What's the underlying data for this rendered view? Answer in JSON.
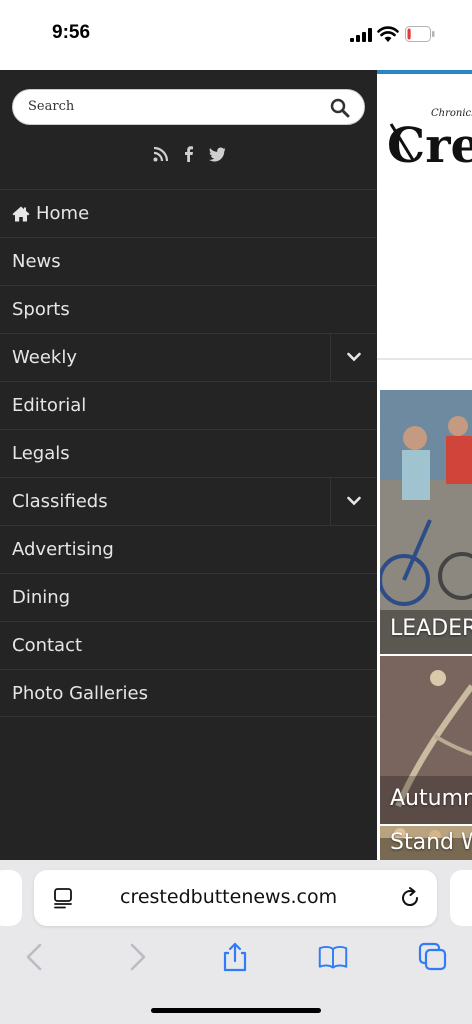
{
  "status": {
    "time": "9:56",
    "battery_level": 0.15,
    "battery_color": "#e53b30"
  },
  "menu": {
    "search_placeholder": "Search",
    "social_icons": [
      "rss-icon",
      "facebook-icon",
      "twitter-icon"
    ],
    "items": [
      {
        "label": "Home",
        "icon": "home-icon"
      },
      {
        "label": "News"
      },
      {
        "label": "Sports"
      },
      {
        "label": "Weekly",
        "expandable": true
      },
      {
        "label": "Editorial"
      },
      {
        "label": "Legals"
      },
      {
        "label": "Classifieds",
        "expandable": true
      },
      {
        "label": "Advertising"
      },
      {
        "label": "Dining"
      },
      {
        "label": "Contact"
      },
      {
        "label": "Photo Galleries"
      }
    ]
  },
  "page": {
    "masthead_small": "Chronicle",
    "masthead_big": "Cre",
    "tiles": [
      {
        "caption": "LEADER"
      },
      {
        "caption": "Autumn"
      },
      {
        "caption": "Stand W"
      }
    ]
  },
  "browser": {
    "url": "crestedbuttenews.com"
  },
  "colors": {
    "menu_bg": "#242424",
    "accent": "#2a84c6",
    "toolbar_icon": "#2f7cf6"
  }
}
